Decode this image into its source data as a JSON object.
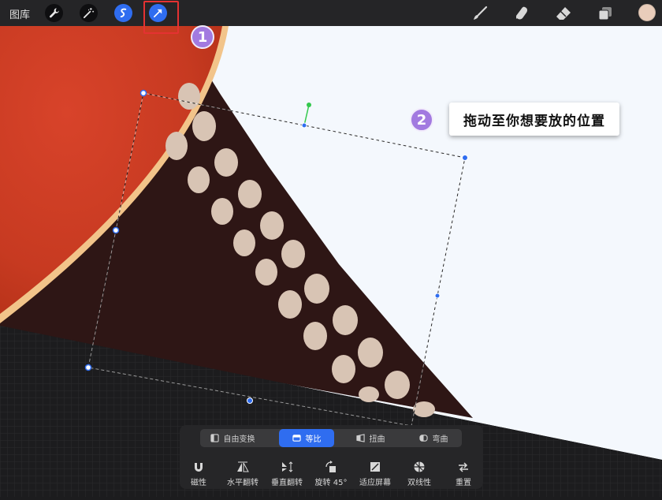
{
  "topbar": {
    "gallery_label": "图库",
    "left_tools": [
      "wrench-icon",
      "magic-wand-icon",
      "selection-icon",
      "transform-arrow-icon"
    ],
    "right_tools": [
      "brush-icon",
      "smudge-icon",
      "eraser-icon",
      "layers-icon"
    ],
    "current_color": "#e9cdbb"
  },
  "annotations": {
    "step1": "1",
    "step2": "2",
    "tip": "拖动至你想要放的位置",
    "highlight_color": "#e43232",
    "badge_color": "#a27ae0"
  },
  "transform_modes": [
    {
      "label": "自由变换",
      "active": false
    },
    {
      "label": "等比",
      "active": true
    },
    {
      "label": "扭曲",
      "active": false
    },
    {
      "label": "弯曲",
      "active": false
    }
  ],
  "tools": [
    {
      "label": "磁性"
    },
    {
      "label": "水平翻转"
    },
    {
      "label": "垂直翻转"
    },
    {
      "label": "旋转 45°"
    },
    {
      "label": "适应屏幕"
    },
    {
      "label": "双线性"
    },
    {
      "label": "重置"
    }
  ],
  "colors": {
    "accent": "#2f6df0",
    "canvas_white": "#f4f8fd",
    "brown": "#2e1615",
    "red": "#cf3a22",
    "dots": "#d8c4b4"
  }
}
